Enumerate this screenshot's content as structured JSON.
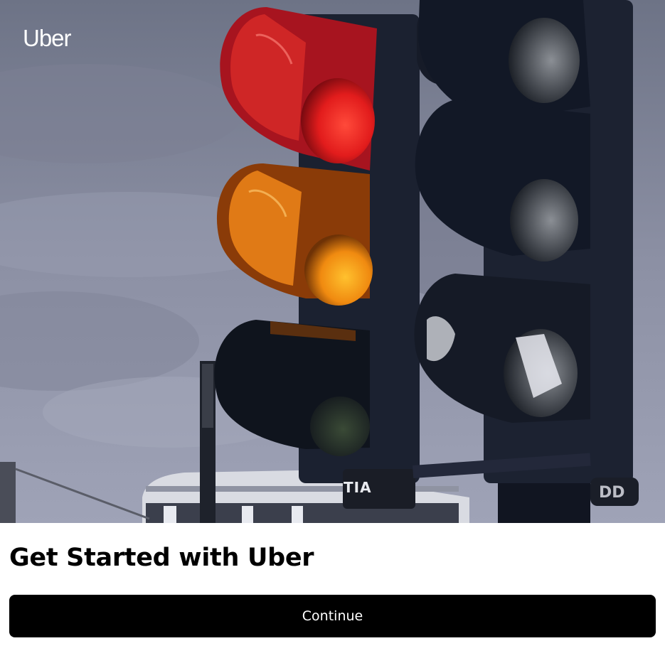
{
  "brand": {
    "logo_text": "Uber"
  },
  "hero": {
    "image_subject": "traffic-lights-photo",
    "sign_text": "TIA"
  },
  "main": {
    "title": "Get Started with Uber",
    "continue_label": "Continue"
  },
  "colors": {
    "button_background": "#000000",
    "button_text": "#ffffff",
    "page_background": "#ffffff",
    "title_text": "#000000"
  }
}
